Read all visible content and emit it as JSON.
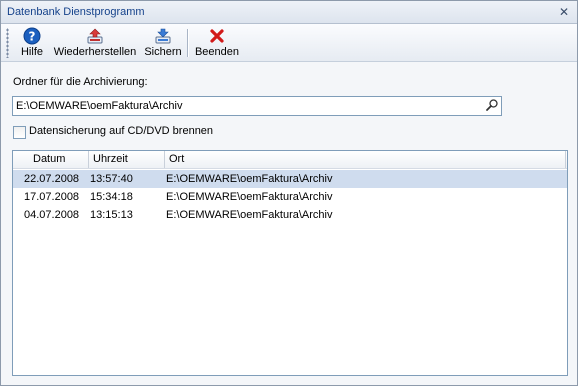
{
  "window": {
    "title": "Datenbank Dienstprogramm",
    "close_glyph": "✕"
  },
  "toolbar": {
    "help_label": "Hilfe",
    "restore_label": "Wiederherstellen",
    "backup_label": "Sichern",
    "exit_label": "Beenden"
  },
  "archive": {
    "folder_label": "Ordner für die Archivierung:",
    "folder_value": "E:\\OEMWARE\\oemFaktura\\Archiv",
    "burn_label": "Datensicherung auf CD/DVD brennen",
    "burn_checked": false
  },
  "list": {
    "columns": [
      "Datum",
      "Uhrzeit",
      "Ort"
    ],
    "rows": [
      {
        "datum": "22.07.2008",
        "uhrzeit": "13:57:40",
        "ort": "E:\\OEMWARE\\oemFaktura\\Archiv",
        "selected": true
      },
      {
        "datum": "17.07.2008",
        "uhrzeit": "15:34:18",
        "ort": "E:\\OEMWARE\\oemFaktura\\Archiv",
        "selected": false
      },
      {
        "datum": "04.07.2008",
        "uhrzeit": "13:15:13",
        "ort": "E:\\OEMWARE\\oemFaktura\\Archiv",
        "selected": false
      }
    ]
  },
  "icons": {
    "help": "help-icon",
    "restore": "restore-icon",
    "backup": "backup-icon",
    "exit": "exit-icon",
    "search": "search-icon"
  },
  "colors": {
    "title_text": "#15428b",
    "selection": "#cfdcee",
    "exit_red": "#d21a1a",
    "help_blue": "#1b5fbf"
  }
}
